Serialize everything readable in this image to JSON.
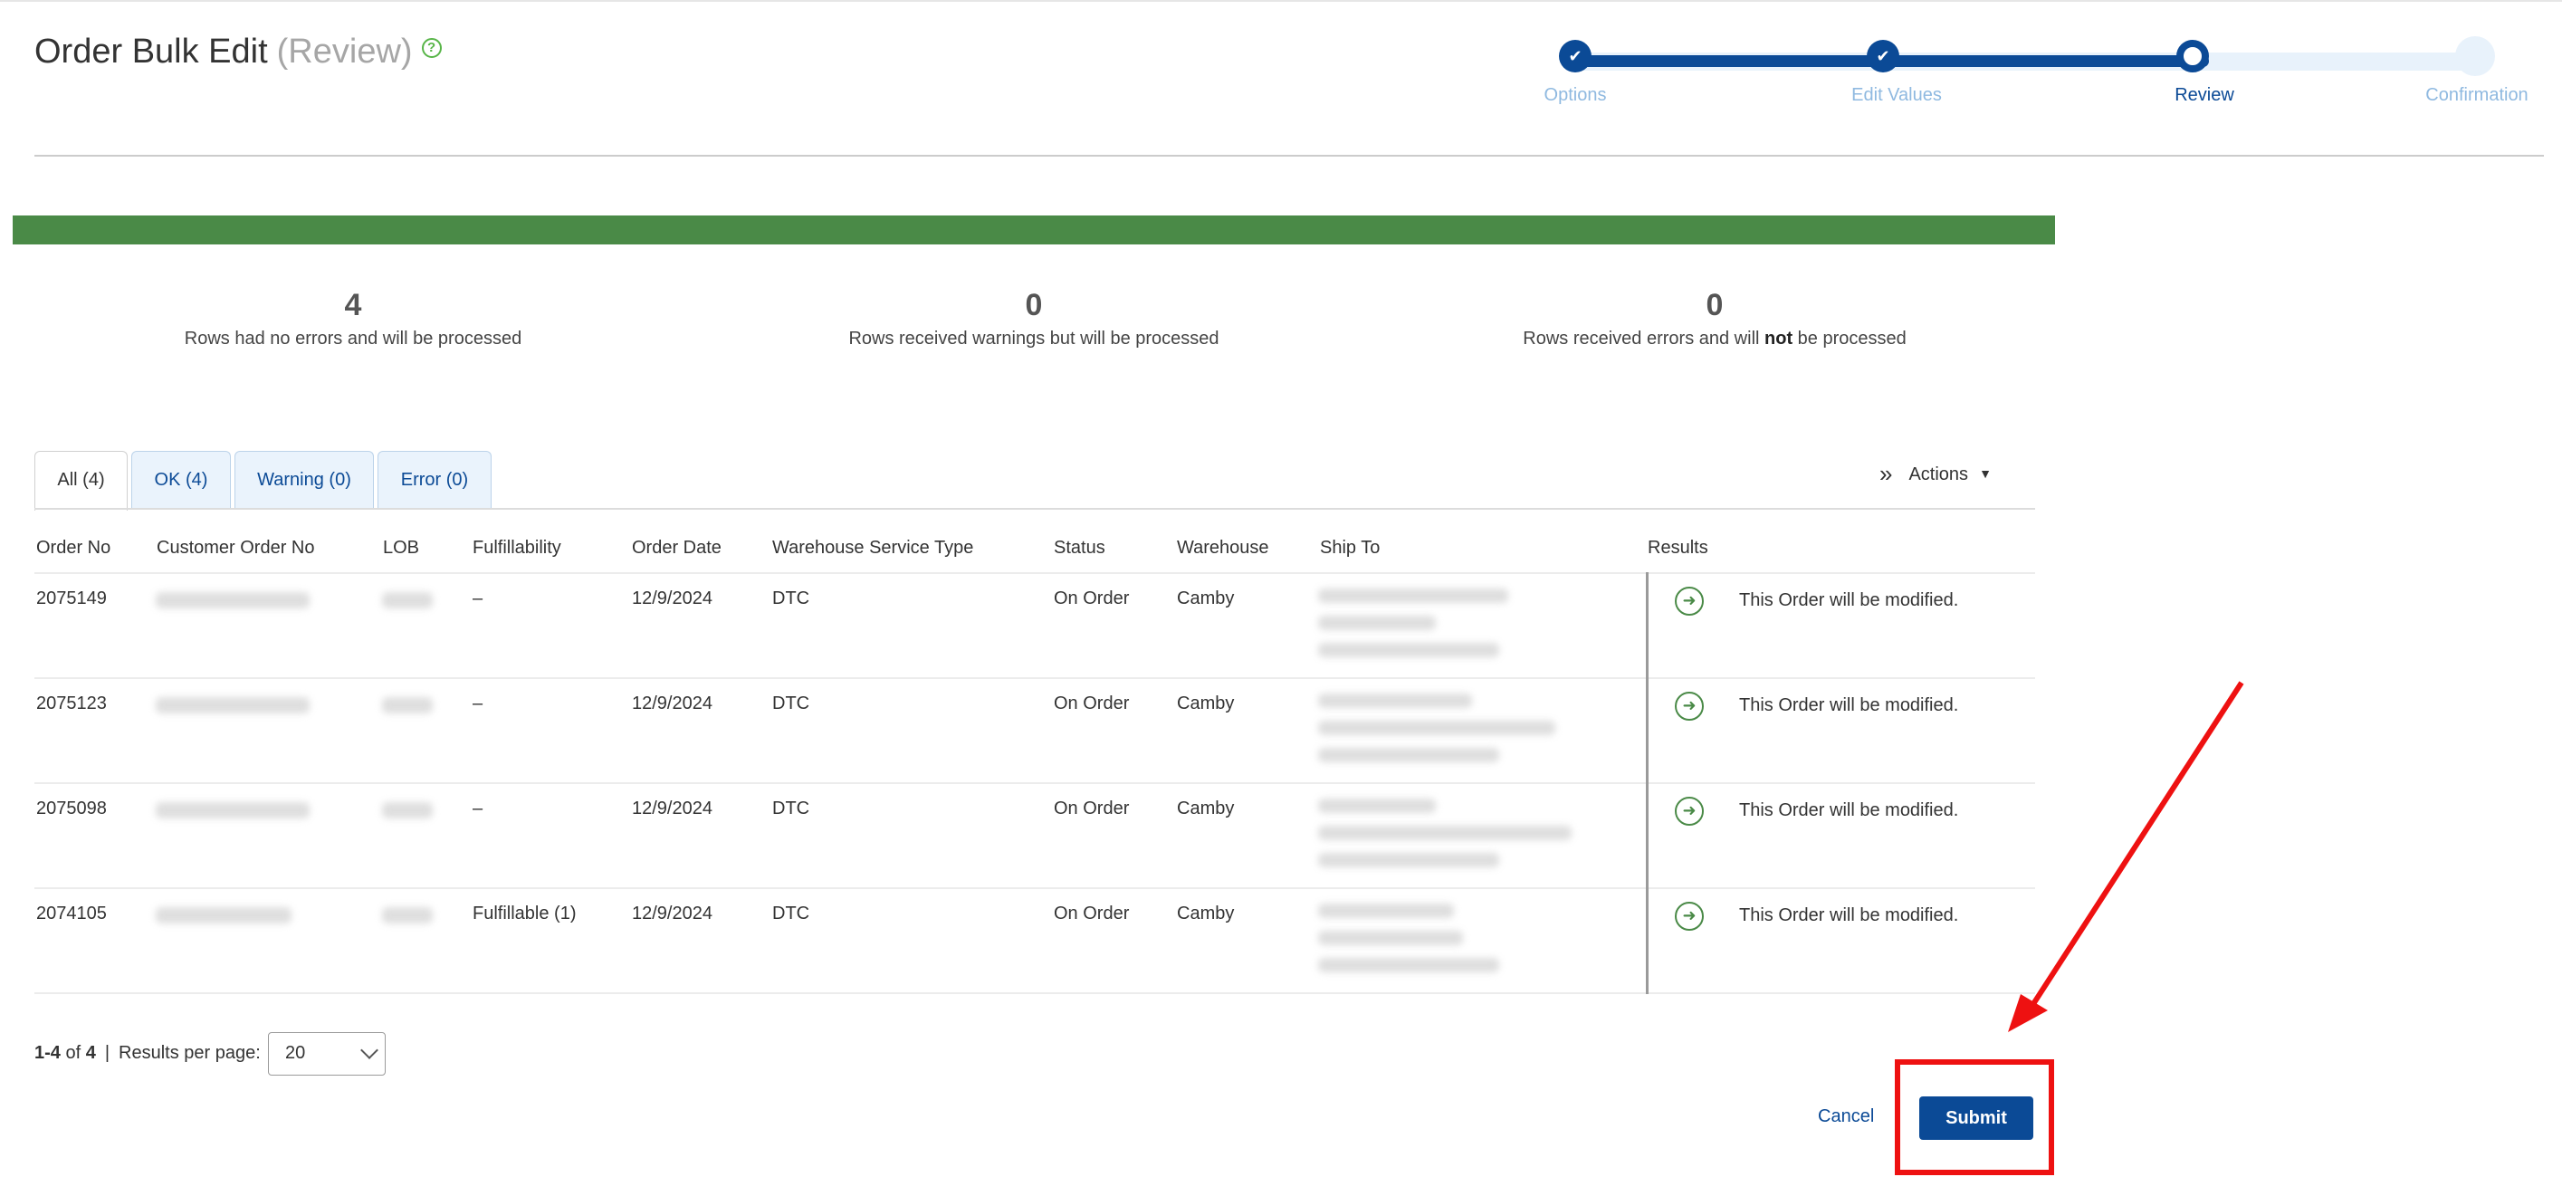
{
  "header": {
    "title": "Order Bulk Edit",
    "subtitle": "(Review)",
    "help_icon": "?"
  },
  "stepper": {
    "steps": [
      {
        "label": "Options",
        "state": "done"
      },
      {
        "label": "Edit Values",
        "state": "done"
      },
      {
        "label": "Review",
        "state": "current"
      },
      {
        "label": "Confirmation",
        "state": "future"
      }
    ],
    "check_glyph": "✔"
  },
  "progress": {
    "fraction": 1.0,
    "color": "#4a8a47"
  },
  "stats": [
    {
      "value": "4",
      "pre": "Rows had no errors and will be processed",
      "bold": "",
      "post": ""
    },
    {
      "value": "0",
      "pre": "Rows received warnings but will be processed",
      "bold": "",
      "post": ""
    },
    {
      "value": "0",
      "pre": "Rows received errors and will ",
      "bold": "not",
      "post": " be processed"
    }
  ],
  "tabs": [
    {
      "label": "All (4)",
      "active": true
    },
    {
      "label": "OK (4)",
      "active": false
    },
    {
      "label": "Warning (0)",
      "active": false
    },
    {
      "label": "Error (0)",
      "active": false
    }
  ],
  "actions": {
    "label": "Actions",
    "icon": "»",
    "caret": "▼"
  },
  "table": {
    "columns": [
      "Order No",
      "Customer Order No",
      "LOB",
      "Fulfillability",
      "Order Date",
      "Warehouse Service Type",
      "Status",
      "Warehouse",
      "Ship To",
      "Results"
    ],
    "rows": [
      {
        "order_no": "2075149",
        "fulfillability": "–",
        "order_date": "12/9/2024",
        "service_type": "DTC",
        "status": "On Order",
        "warehouse": "Camby",
        "result": "This Order will be modified."
      },
      {
        "order_no": "2075123",
        "fulfillability": "–",
        "order_date": "12/9/2024",
        "service_type": "DTC",
        "status": "On Order",
        "warehouse": "Camby",
        "result": "This Order will be modified."
      },
      {
        "order_no": "2075098",
        "fulfillability": "–",
        "order_date": "12/9/2024",
        "service_type": "DTC",
        "status": "On Order",
        "warehouse": "Camby",
        "result": "This Order will be modified."
      },
      {
        "order_no": "2074105",
        "fulfillability": "Fulfillable (1)",
        "order_date": "12/9/2024",
        "service_type": "DTC",
        "status": "On Order",
        "warehouse": "Camby",
        "result": "This Order will be modified."
      }
    ],
    "result_icon": "➜"
  },
  "pagination": {
    "range": "1-4",
    "of": "of",
    "total": "4",
    "sep": "|",
    "per_page_label": "Results per page:",
    "per_page_value": "20"
  },
  "footer": {
    "cancel_label": "Cancel",
    "submit_label": "Submit"
  },
  "colors": {
    "brand": "#0b4a96",
    "success": "#4a8a47",
    "annotation": "#ee1111"
  }
}
